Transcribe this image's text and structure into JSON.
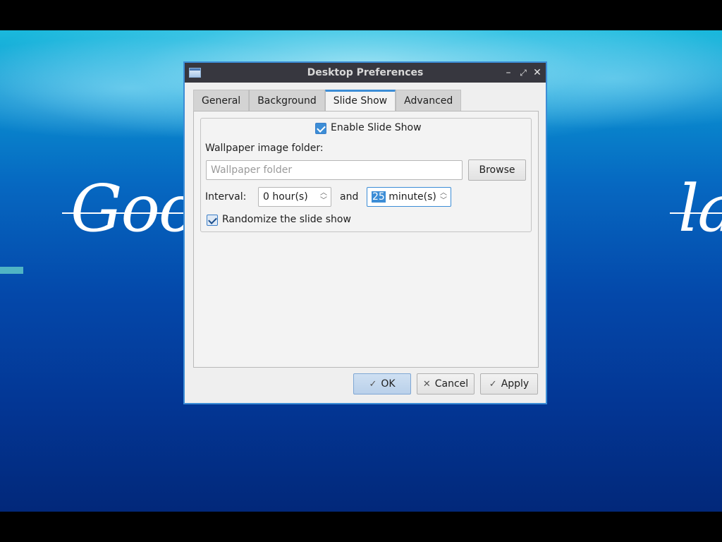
{
  "wallpaper": {
    "left_text": "Goo",
    "right_text": "la"
  },
  "window": {
    "title": "Desktop Preferences",
    "app_icon": "window-icon",
    "controls": {
      "minimize": "–",
      "maximize": "⤢",
      "close": "✕"
    }
  },
  "tabs": [
    {
      "label": "General",
      "active": false
    },
    {
      "label": "Background",
      "active": false
    },
    {
      "label": "Slide Show",
      "active": true
    },
    {
      "label": "Advanced",
      "active": false
    }
  ],
  "slideshow": {
    "enable_label": "Enable Slide Show",
    "enable_checked": true,
    "folder_label": "Wallpaper image folder:",
    "folder_value": "",
    "folder_placeholder": "Wallpaper folder",
    "browse_label": "Browse",
    "interval_label": "Interval:",
    "hours_value": "0",
    "hours_suffix": " hour(s)",
    "and_label": "and",
    "minutes_value": "25",
    "minutes_suffix": " minute(s)",
    "randomize_label": "Randomize the slide show",
    "randomize_checked": true
  },
  "buttons": {
    "ok": "OK",
    "ok_icon": "✓",
    "cancel": "Cancel",
    "cancel_icon": "✕",
    "apply": "Apply",
    "apply_icon": "✓"
  },
  "colors": {
    "accent": "#3c8dd6",
    "titlebar": "#37373f"
  }
}
